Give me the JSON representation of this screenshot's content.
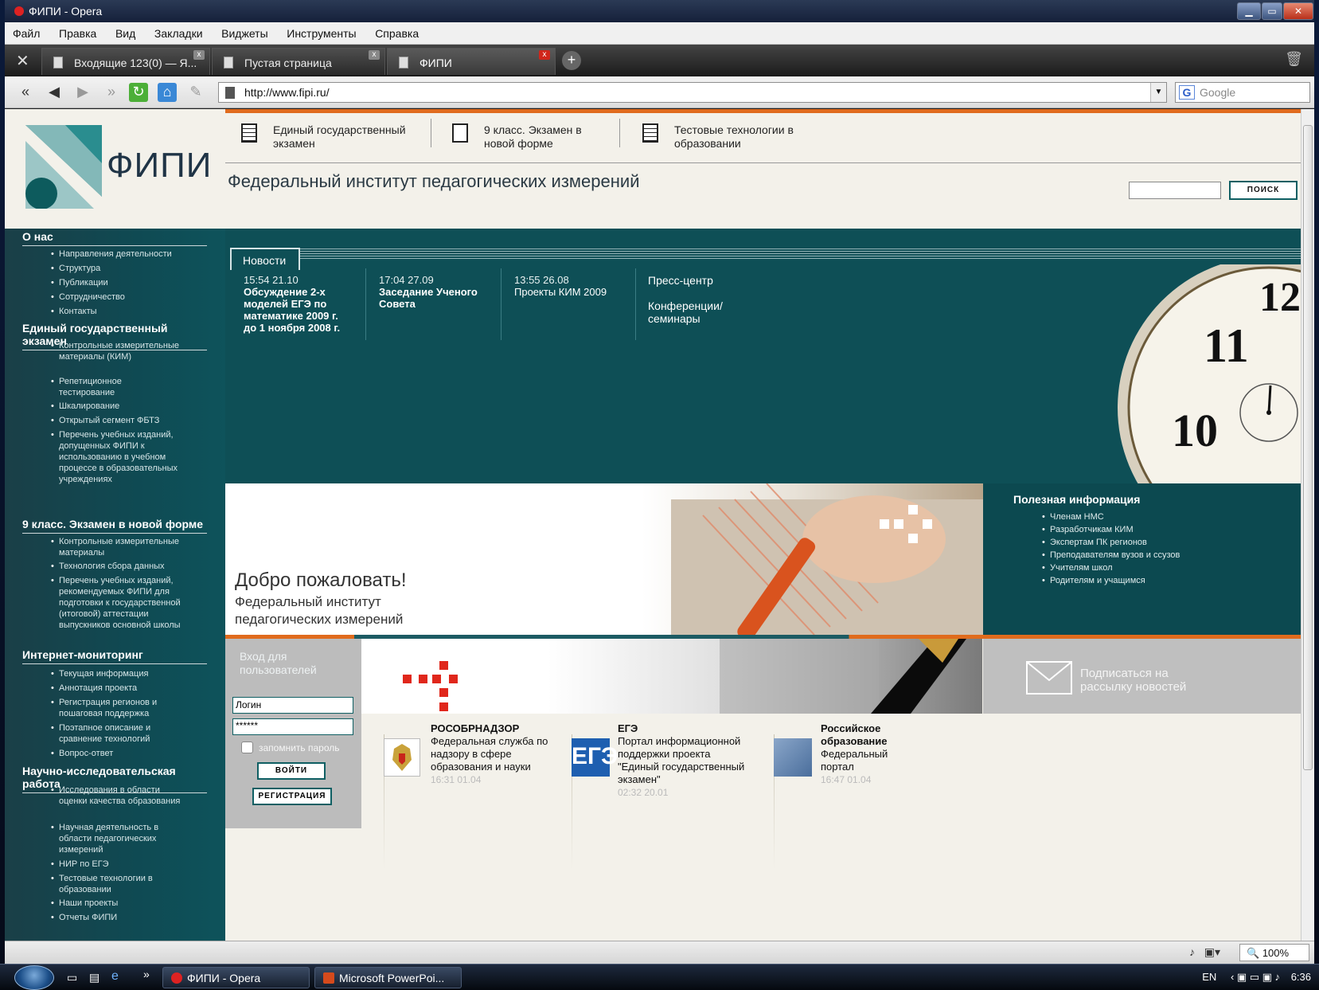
{
  "window": {
    "title": "ФИПИ - Opera",
    "controls": [
      "minimize",
      "maximize",
      "close"
    ]
  },
  "menu": [
    "Файл",
    "Правка",
    "Вид",
    "Закладки",
    "Виджеты",
    "Инструменты",
    "Справка"
  ],
  "tabs": [
    {
      "label": "Входящие 123(0) — Я...",
      "active": false
    },
    {
      "label": "Пустая страница",
      "active": false
    },
    {
      "label": "ФИПИ",
      "active": true
    }
  ],
  "nav": {
    "url": "http://www.fipi.ru/",
    "search_placeholder": "Google"
  },
  "site": {
    "logo_text": "ФИПИ",
    "topnav": [
      "Единый государственный экзамен",
      "9 класс. Экзамен в новой форме",
      "Тестовые технологии в образовании"
    ],
    "institute_name": "Федеральный институт педагогических измерений",
    "search_button": "ПОИСК"
  },
  "sidebar": {
    "sections": [
      {
        "title": "О нас",
        "items": [
          "Направления деятельности",
          "Структура",
          "Публикации",
          "Сотрудничество",
          "Контакты"
        ]
      },
      {
        "title": "Единый государственный экзамен",
        "items": [
          "Контрольные измерительные материалы (КИМ)",
          "Репетиционное тестирование",
          "Шкалирование",
          "Открытый сегмент ФБТЗ",
          "Перечень учебных изданий, допущенных ФИПИ к использованию в учебном процессе в образовательных учреждениях"
        ]
      },
      {
        "title": "9 класс. Экзамен в новой форме",
        "items": [
          "Контрольные измерительные материалы",
          "Технология сбора данных",
          "Перечень учебных изданий, рекомендуемых ФИПИ для подготовки к государственной (итоговой) аттестации выпускников основной школы"
        ]
      },
      {
        "title": "Интернет-мониторинг",
        "items": [
          "Текущая информация",
          "Аннотация проекта",
          "Регистрация регионов и пошаговая поддержка",
          "Поэтапное описание и сравнение технологий",
          "Вопрос-ответ"
        ]
      },
      {
        "title": "Научно-исследовательская работа",
        "items": [
          "Исследования в области оценки качества образования",
          "Научная деятельность в области педагогических измерений",
          "НИР по ЕГЭ",
          "Тестовые технологии в образовании",
          "Наши проекты",
          "Отчеты ФИПИ"
        ]
      }
    ]
  },
  "news": {
    "tab_label": "Новости",
    "items": [
      {
        "date": "15:54 21.10",
        "title": "Обсуждение 2-х моделей ЕГЭ по математике 2009 г. до 1 ноября 2008 г."
      },
      {
        "date": "17:04 27.09",
        "title": "Заседание Ученого Совета"
      },
      {
        "date": "13:55 26.08",
        "title": "Проекты КИМ 2009"
      }
    ],
    "press_center": "Пресс-центр",
    "conferences": "Конференции/ семинары"
  },
  "welcome": {
    "title": "Добро пожаловать!",
    "subtitle": "Федеральный институт педагогических измерений"
  },
  "useful": {
    "title": "Полезная информация",
    "items": [
      "Членам НМС",
      "Разработчикам КИМ",
      "Экспертам ПК регионов",
      "Преподавателям вузов и ссузов",
      "Учителям школ",
      "Родителям и учащимся"
    ]
  },
  "login": {
    "title": "Вход для пользователей",
    "login_value": "Логин",
    "password_value": "******",
    "remember_label": "запомнить пароль",
    "login_button": "ВОЙТИ",
    "register_button": "РЕГИСТРАЦИЯ"
  },
  "subscribe": {
    "text": "Подписаться на рассылку новостей"
  },
  "partners": [
    {
      "name": "РОСОБРНАДЗОР",
      "desc": "Федеральная служба по надзору в сфере образования и науки",
      "date": "16:31 01.04"
    },
    {
      "name": "ЕГЭ",
      "desc": "Портал информационной поддержки проекта \"Единый государственный экзамен\"",
      "date": "02:32 20.01"
    },
    {
      "name": "Российское образование",
      "desc": "Федеральный портал",
      "date": "16:47 01.04"
    }
  ],
  "statusbar": {
    "zoom": "100%"
  },
  "taskbar": {
    "items": [
      "ФИПИ - Opera",
      "Microsoft PowerPoi..."
    ],
    "lang": "EN",
    "time": "6:36"
  },
  "colors": {
    "teal": "#0e4f56",
    "orange": "#e06b1d",
    "page_bg": "#f3f1ea"
  }
}
